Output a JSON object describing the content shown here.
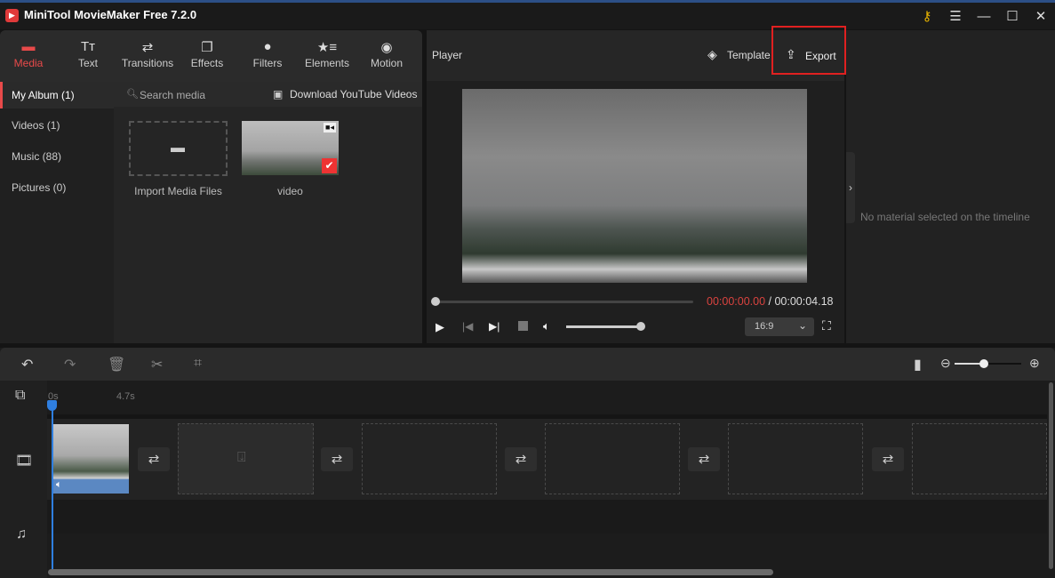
{
  "app": {
    "title": "MiniTool MovieMaker Free 7.2.0"
  },
  "window_controls": [
    "key-icon",
    "menu-icon",
    "minimize-icon",
    "maximize-icon",
    "close-icon"
  ],
  "toolbar": {
    "items": [
      {
        "label": "Media",
        "icon": "folder-icon",
        "active": true
      },
      {
        "label": "Text",
        "icon": "text-icon"
      },
      {
        "label": "Transitions",
        "icon": "transitions-icon"
      },
      {
        "label": "Effects",
        "icon": "effects-icon"
      },
      {
        "label": "Filters",
        "icon": "filters-icon"
      },
      {
        "label": "Elements",
        "icon": "elements-icon"
      },
      {
        "label": "Motion",
        "icon": "motion-icon"
      }
    ]
  },
  "sidebar": {
    "items": [
      {
        "label": "My Album (1)",
        "active": true
      },
      {
        "label": "Videos (1)"
      },
      {
        "label": "Music (88)"
      },
      {
        "label": "Pictures (0)"
      }
    ]
  },
  "media": {
    "search_placeholder": "Search media",
    "download_label": "Download YouTube Videos",
    "import_label": "Import Media Files",
    "video_label": "video"
  },
  "player": {
    "title": "Player",
    "template_label": "Template",
    "export_label": "Export",
    "current_time": "00:00:00.00",
    "separator": " / ",
    "total_time": "00:00:04.18",
    "aspect_ratio": "16:9",
    "volume": 1.0,
    "progress": 0
  },
  "right_panel": {
    "empty_text": "No material selected on the timeline"
  },
  "timeline": {
    "ruler": [
      "0s",
      "4.7s"
    ],
    "zoom_level": 0.45
  },
  "colors": {
    "accent": "#e84a4a",
    "playhead": "#2f7fe0",
    "export_highlight": "#e02020"
  }
}
